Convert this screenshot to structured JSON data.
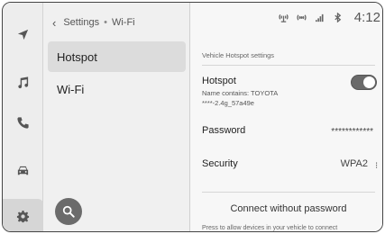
{
  "nav_rail": {
    "items": [
      {
        "icon": "navigation-arrow-icon"
      },
      {
        "icon": "music-note-icon"
      },
      {
        "icon": "phone-icon"
      },
      {
        "icon": "car-icon"
      },
      {
        "icon": "gear-icon"
      }
    ]
  },
  "list_pane": {
    "breadcrumb": {
      "parent": "Settings",
      "separator": "•",
      "current": "Wi-Fi"
    },
    "items": [
      {
        "label": "Hotspot",
        "selected": true
      },
      {
        "label": "Wi-Fi",
        "selected": false
      }
    ],
    "search_icon": "search-icon"
  },
  "status_bar": {
    "icons": [
      "hotspot-antenna-icon",
      "signal-waves-icon",
      "cellular-signal-icon",
      "bluetooth-icon"
    ],
    "clock": "4:12"
  },
  "detail": {
    "section_label": "Vehicle Hotspot settings",
    "hotspot": {
      "title": "Hotspot",
      "name_line": "Name contains: TOYOTA",
      "ssid_line": "****-2.4g_57a49e",
      "enabled": true
    },
    "password": {
      "label": "Password",
      "value": "************"
    },
    "security": {
      "label": "Security",
      "value": "WPA2",
      "menu_glyph": "⁝"
    },
    "connect_button": "Connect without password",
    "footnote": "Press to allow devices in your vehicle to connect"
  }
}
